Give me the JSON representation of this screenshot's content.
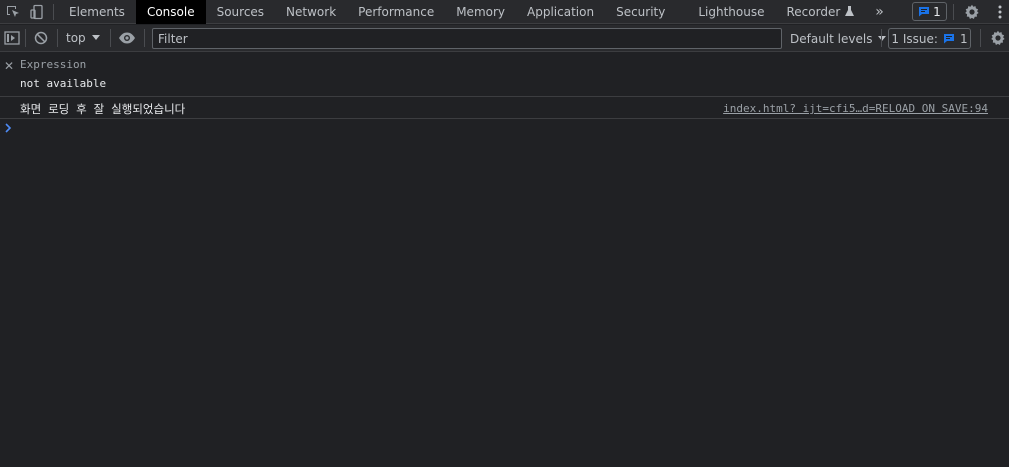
{
  "tabs": [
    {
      "label": "Elements",
      "active": false
    },
    {
      "label": "Console",
      "active": true
    },
    {
      "label": "Sources",
      "active": false
    },
    {
      "label": "Network",
      "active": false
    },
    {
      "label": "Performance",
      "active": false
    },
    {
      "label": "Memory",
      "active": false
    },
    {
      "label": "Application",
      "active": false
    },
    {
      "label": "Security",
      "active": false
    },
    {
      "label": "Lighthouse",
      "active": false
    },
    {
      "label": "Recorder",
      "active": false
    }
  ],
  "more_tabs": "»",
  "issue_badge_count": "1",
  "toolbar": {
    "context": "top",
    "filter_placeholder": "Filter",
    "levels": "Default levels",
    "issues_label": "1 Issue:",
    "issues_count": "1"
  },
  "live_expression": {
    "label": "Expression",
    "value": "not available"
  },
  "messages": [
    {
      "text": "화면 로딩 후 잘 실행되었습니다",
      "source": "index.html? ijt=cfi5…d=RELOAD ON SAVE:94"
    }
  ],
  "colors": {
    "accent": "#1a73e8",
    "prompt": "#4e8bf5",
    "background": "#202124",
    "toolbar": "#292a2d"
  }
}
